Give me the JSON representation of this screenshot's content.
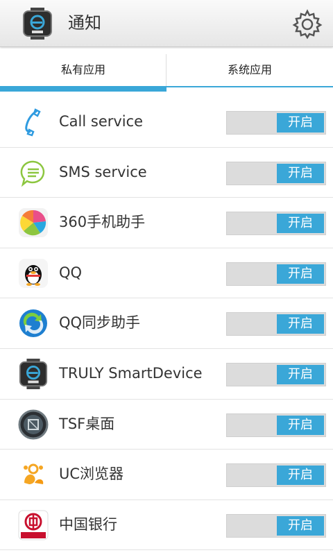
{
  "header": {
    "title": "通知",
    "app_icon": "truly-watch-icon",
    "settings_icon": "gear-icon"
  },
  "tabs": [
    {
      "label": "私有应用",
      "selected": true
    },
    {
      "label": "系统应用",
      "selected": false
    }
  ],
  "colors": {
    "accent": "#3aa7d8",
    "toggle_track": "#dcdcdc"
  },
  "apps": [
    {
      "name": "Call service",
      "icon": "phone-icon",
      "toggle": "开启",
      "on": true
    },
    {
      "name": "SMS service",
      "icon": "sms-bubble-icon",
      "toggle": "开启",
      "on": true
    },
    {
      "name": "360手机助手",
      "icon": "360-assistant-icon",
      "toggle": "开启",
      "on": true
    },
    {
      "name": "QQ",
      "icon": "qq-penguin-icon",
      "toggle": "开启",
      "on": true
    },
    {
      "name": "QQ同步助手",
      "icon": "qq-sync-icon",
      "toggle": "开启",
      "on": true
    },
    {
      "name": "TRULY SmartDevice",
      "icon": "truly-watch-icon",
      "toggle": "开启",
      "on": true
    },
    {
      "name": "TSF桌面",
      "icon": "tsf-desktop-icon",
      "toggle": "开启",
      "on": true
    },
    {
      "name": "UC浏览器",
      "icon": "uc-browser-icon",
      "toggle": "开启",
      "on": true
    },
    {
      "name": "中国银行",
      "icon": "bank-of-china-icon",
      "toggle": "开启",
      "on": true
    }
  ]
}
